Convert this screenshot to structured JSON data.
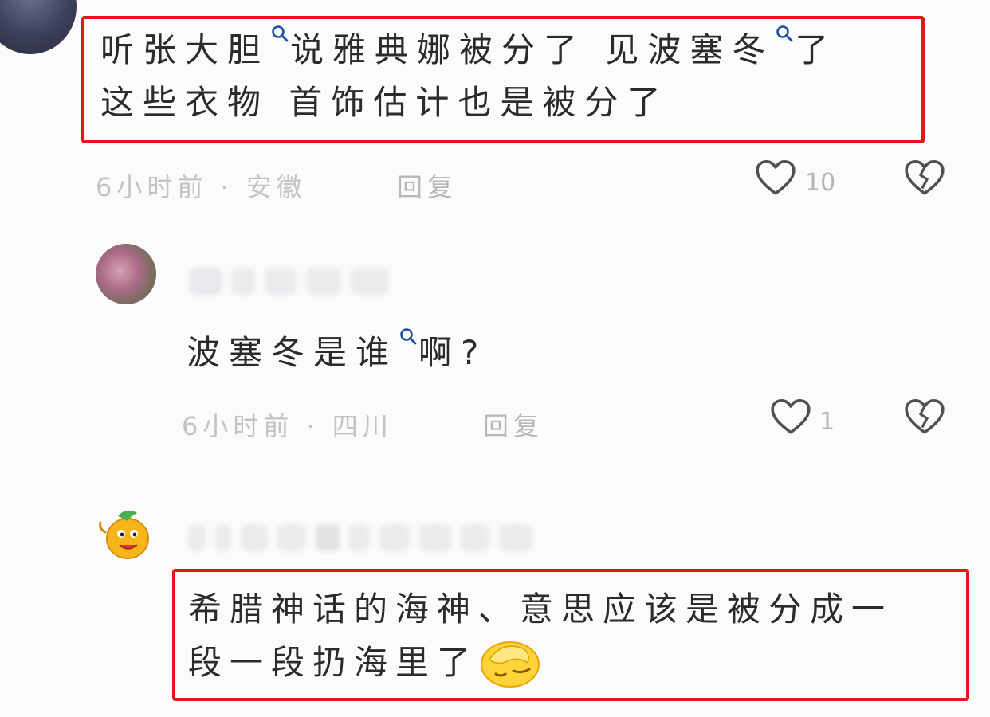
{
  "comments": [
    {
      "text_line1_a": "听张大胆",
      "text_line1_b": "说雅典娜被分了 见波塞冬",
      "text_line1_c": "了",
      "text_line2": "这些衣物 首饰估计也是被分了",
      "meta": "6小时前 · 安徽",
      "reply": "回复",
      "likes": "10"
    },
    {
      "text_a": "波塞冬是谁",
      "text_b": "啊?",
      "meta": "6小时前 · 四川",
      "reply": "回复",
      "likes": "1"
    },
    {
      "text_line1": "希腊神话的海神、意思应该是被分成一",
      "text_line2": "段一段扔海里了"
    }
  ],
  "icons": {
    "like": "heart-outline-icon",
    "dislike": "broken-heart-icon",
    "search": "search-icon",
    "emoji": "facepalm-emoji"
  },
  "colors": {
    "highlight": "#e2161b",
    "meta": "#c3c3c6"
  }
}
